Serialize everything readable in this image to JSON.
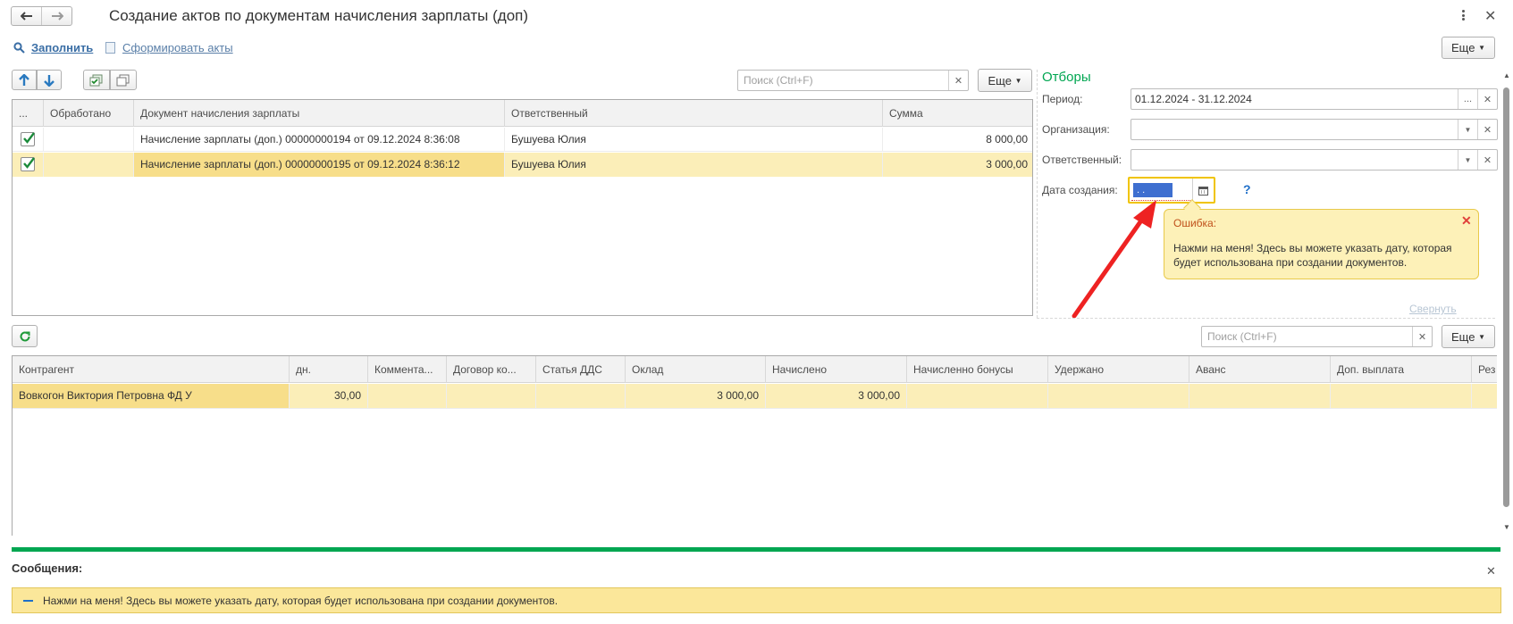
{
  "window": {
    "title": "Создание актов по документам начисления зарплаты (доп)"
  },
  "commands": {
    "fill_label": "Заполнить",
    "form_acts_label": "Сформировать акты",
    "more_label": "Еще"
  },
  "top_table": {
    "search_placeholder": "Поиск (Ctrl+F)",
    "more_label": "Еще",
    "columns": [
      "...",
      "Обработано",
      "Документ начисления зарплаты",
      "Ответственный",
      "Сумма"
    ],
    "rows": [
      {
        "checked": true,
        "processed": "",
        "document": "Начисление зарплаты (доп.) 00000000194 от 09.12.2024 8:36:08",
        "responsible": "Бушуева Юлия",
        "sum": "8 000,00"
      },
      {
        "checked": true,
        "processed": "",
        "document": "Начисление зарплаты (доп.) 00000000195 от 09.12.2024 8:36:12",
        "responsible": "Бушуева Юлия",
        "sum": "3 000,00"
      }
    ]
  },
  "filters": {
    "title": "Отборы",
    "period_label": "Период:",
    "period_value": "01.12.2024 - 31.12.2024",
    "org_label": "Организация:",
    "org_value": "",
    "resp_label": "Ответственный:",
    "resp_value": "",
    "date_label": "Дата создания:",
    "date_value": " .  .",
    "help": "?",
    "collapse_label": "Свернуть"
  },
  "tooltip": {
    "title": "Ошибка:",
    "text": "Нажми на меня! Здесь вы можете указать дату, которая будет использована при создании документов."
  },
  "bottom_table": {
    "search_placeholder": "Поиск (Ctrl+F)",
    "more_label": "Еще",
    "columns": [
      "Контрагент",
      "дн.",
      "Коммента...",
      "Договор ко...",
      "Статья ДДС",
      "Оклад",
      "Начислено",
      "Начисленно бонусы",
      "Удержано",
      "Аванс",
      "Доп. выплата",
      "Рез"
    ],
    "rows": [
      {
        "counterparty": "Вовкогон Виктория Петровна ФД У",
        "days": "30,00",
        "comment": "",
        "contract": "",
        "dds": "",
        "salary": "3 000,00",
        "accrued": "3 000,00",
        "bonus": "",
        "withheld": "",
        "advance": "",
        "extra": "",
        "rez": ""
      }
    ]
  },
  "messages": {
    "title": "Сообщения:",
    "items": [
      "Нажми на меня! Здесь вы можете указать дату, которая будет использована при создании документов."
    ]
  },
  "colors": {
    "accent_green": "#00a651",
    "selection": "#fbeeb8",
    "tooltip_bg": "#fdf1b8",
    "error_red": "#e0403a"
  }
}
